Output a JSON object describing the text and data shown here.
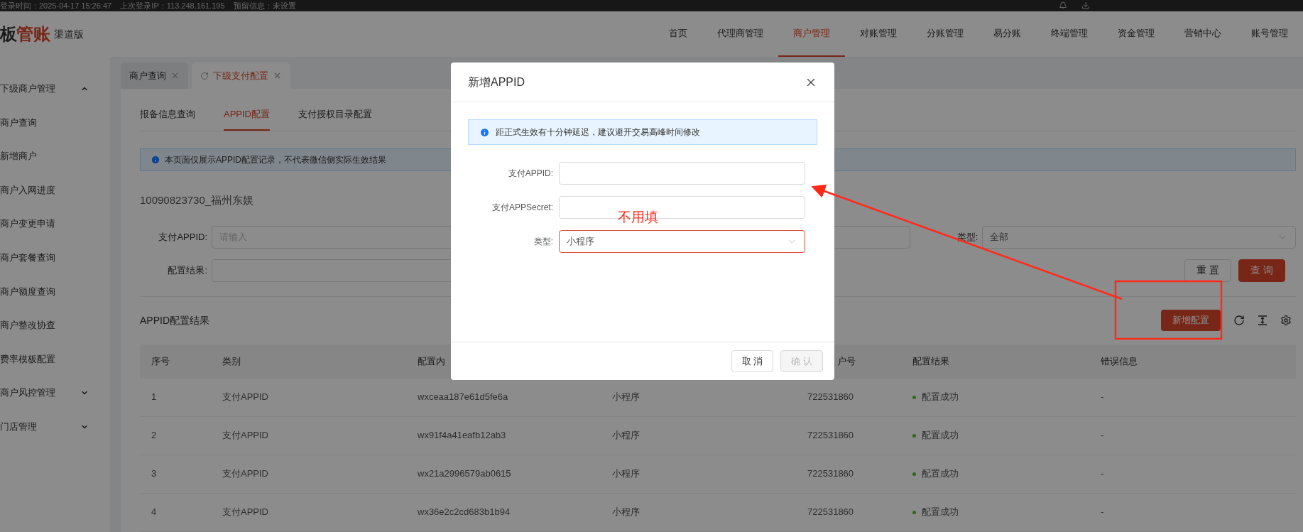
{
  "top_bar": {
    "login_info": "登录时间：2025-04-17 15:26:47    上次登录IP：113.248.161.195    预留信息：未设置"
  },
  "header": {
    "logo": "板管账",
    "edition": "渠道版",
    "nav": [
      {
        "label": "首页",
        "selected": false
      },
      {
        "label": "代理商管理",
        "selected": false
      },
      {
        "label": "商户管理",
        "selected": true
      },
      {
        "label": "对账管理",
        "selected": false
      },
      {
        "label": "分账管理",
        "selected": false
      },
      {
        "label": "易分账",
        "selected": false
      },
      {
        "label": "终端管理",
        "selected": false
      },
      {
        "label": "资金管理",
        "selected": false
      },
      {
        "label": "营销中心",
        "selected": false
      },
      {
        "label": "账号管理",
        "selected": false
      }
    ]
  },
  "sidebar": {
    "items": [
      {
        "label": "下级商户管理",
        "expanded": true,
        "children": [
          {
            "label": "商户查询"
          },
          {
            "label": "新增商户"
          },
          {
            "label": "商户入网进度"
          },
          {
            "label": "商户变更申请"
          },
          {
            "label": "商户套餐查询"
          },
          {
            "label": "商户额度查询"
          },
          {
            "label": "商户整改协查"
          },
          {
            "label": "费率模板配置"
          }
        ]
      },
      {
        "label": "商户风控管理",
        "expanded": false
      },
      {
        "label": "门店管理",
        "expanded": false
      }
    ]
  },
  "page_tabs": [
    {
      "label": "商户查询",
      "selected": false
    },
    {
      "label": "下级支付配置",
      "selected": true
    }
  ],
  "sub_tabs": [
    {
      "label": "报备信息查询",
      "selected": false
    },
    {
      "label": "APPID配置",
      "selected": true
    },
    {
      "label": "支付授权目录配置",
      "selected": false
    }
  ],
  "notice": "本页面仅展示APPID配置记录，不代表微信侧实际生效结果",
  "merchant_title": "10090823730_福州东娱",
  "filters": [
    {
      "kind": "input",
      "label": "支付APPID:",
      "placeholder": "请输入"
    },
    {
      "kind": "input"
    },
    {
      "kind": "select",
      "label": "类型:",
      "value": "全部"
    },
    {
      "kind": "input",
      "label": "配置结果:"
    }
  ],
  "filter_buttons": [
    {
      "label": "重 置",
      "primary": false
    },
    {
      "label": "查 询",
      "primary": true
    }
  ],
  "results": {
    "title": "APPID配置结果",
    "add_button": "新增配置",
    "columns": [
      "序号",
      "类别",
      "配置内",
      "",
      "户号",
      "配置结果",
      "错误信息"
    ],
    "rows": [
      {
        "index": "1",
        "category": "支付APPID",
        "content": "wxceaa187e61d5fe6a",
        "type": "小程序",
        "merchant_no": "722531860",
        "result": "配置成功",
        "error": "-"
      },
      {
        "index": "2",
        "category": "支付APPID",
        "content": "wx91f4a41eafb12ab3",
        "type": "小程序",
        "merchant_no": "722531860",
        "result": "配置成功",
        "error": "-"
      },
      {
        "index": "3",
        "category": "支付APPID",
        "content": "wx21a2996579ab0615",
        "type": "小程序",
        "merchant_no": "722531860",
        "result": "配置成功",
        "error": "-"
      },
      {
        "index": "4",
        "category": "支付APPID",
        "content": "wx36e2c2cd683b1b94",
        "type": "小程序",
        "merchant_no": "722531860",
        "result": "配置成功",
        "error": "-"
      }
    ]
  },
  "modal": {
    "title": "新增APPID",
    "notice": "距正式生效有十分钟延迟，建议避开交易高峰时间修改",
    "fields": [
      {
        "kind": "input",
        "label": "支付APPID:",
        "focused": false
      },
      {
        "kind": "input",
        "label": "支付APPSecret:",
        "focused": false
      },
      {
        "kind": "select",
        "label": "类型:",
        "value": "小程序",
        "focused": true
      }
    ],
    "buttons": [
      {
        "label": "取 消",
        "disabled": false
      },
      {
        "label": "确 认",
        "disabled": true
      }
    ]
  },
  "annotation": {
    "note": "不用填"
  }
}
